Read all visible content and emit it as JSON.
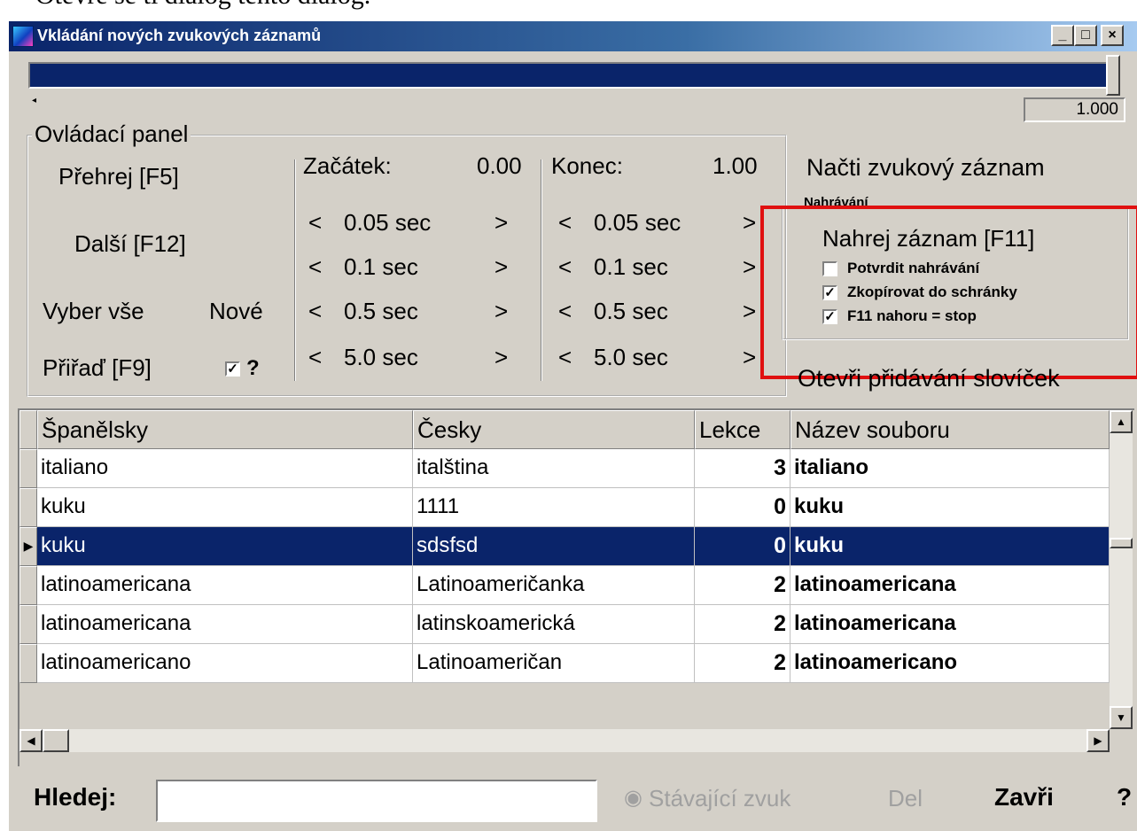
{
  "above_window_text": "Otevře se ti dialog tento dialog.",
  "window": {
    "title": "Vkládání nových zvukových záznamů",
    "minimize": "_",
    "maximize": "□",
    "close": "×"
  },
  "slider": {
    "value_display": "1.000",
    "position_fraction": 1.0
  },
  "control_panel": {
    "legend": "Ovládací panel",
    "play": "Přehrej [F5]",
    "next": "Další [F12]",
    "select_all": "Vyber vše",
    "new": "Nové",
    "assign": "Přiřaď [F9]",
    "assign_checked": true,
    "help": "?",
    "start": {
      "label": "Začátek:",
      "value": "0.00"
    },
    "end": {
      "label": "Konec:",
      "value": "1.00"
    },
    "steps": [
      "< 0.05 sec >",
      "< 0.1 sec >",
      "< 0.5 sec >",
      "< 5.0 sec >"
    ],
    "steps_lt": "<",
    "steps_gt": ">",
    "step_values": [
      "0.05 sec",
      "0.1 sec",
      "0.5 sec",
      "5.0 sec"
    ]
  },
  "load_record": "Načti zvukový záznam",
  "recording": {
    "legend": "Nahrávání",
    "record_button": "Nahrej záznam [F11]",
    "options": [
      {
        "label": "Potvrdit nahrávání",
        "checked": false
      },
      {
        "label": "Zkopírovat do schránky",
        "checked": true
      },
      {
        "label": "F11 nahoru = stop",
        "checked": true
      }
    ]
  },
  "open_words": "Otevři přidávání slovíček",
  "grid": {
    "columns": [
      "Španělsky",
      "Česky",
      "Lekce",
      "Název souboru"
    ],
    "rows": [
      {
        "es": "italiano",
        "cs": "italština",
        "lesson": "3",
        "file": "italiano",
        "selected": false
      },
      {
        "es": "kuku",
        "cs": "1111",
        "lesson": "0",
        "file": "kuku",
        "selected": false
      },
      {
        "es": "kuku",
        "cs": "sdsfsd",
        "lesson": "0",
        "file": "kuku",
        "selected": true
      },
      {
        "es": "latinoamericana",
        "cs": "Latinoameričanka",
        "lesson": "2",
        "file": "latinoamericana",
        "selected": false
      },
      {
        "es": "latinoamericana",
        "cs": "latinskoamerická",
        "lesson": "2",
        "file": "latinoamericana",
        "selected": false
      },
      {
        "es": "latinoamericano",
        "cs": "Latinoameričan",
        "lesson": "2",
        "file": "latinoamericano",
        "selected": false
      }
    ]
  },
  "bottom": {
    "search_label": "Hledej:",
    "search_value": "",
    "current_sound": "Stávající zvuk",
    "delete": "Del",
    "close": "Zavři",
    "help": "?"
  },
  "colors": {
    "selection": "#0a246a",
    "highlight_box": "#e01010",
    "face": "#d4d0c8"
  }
}
